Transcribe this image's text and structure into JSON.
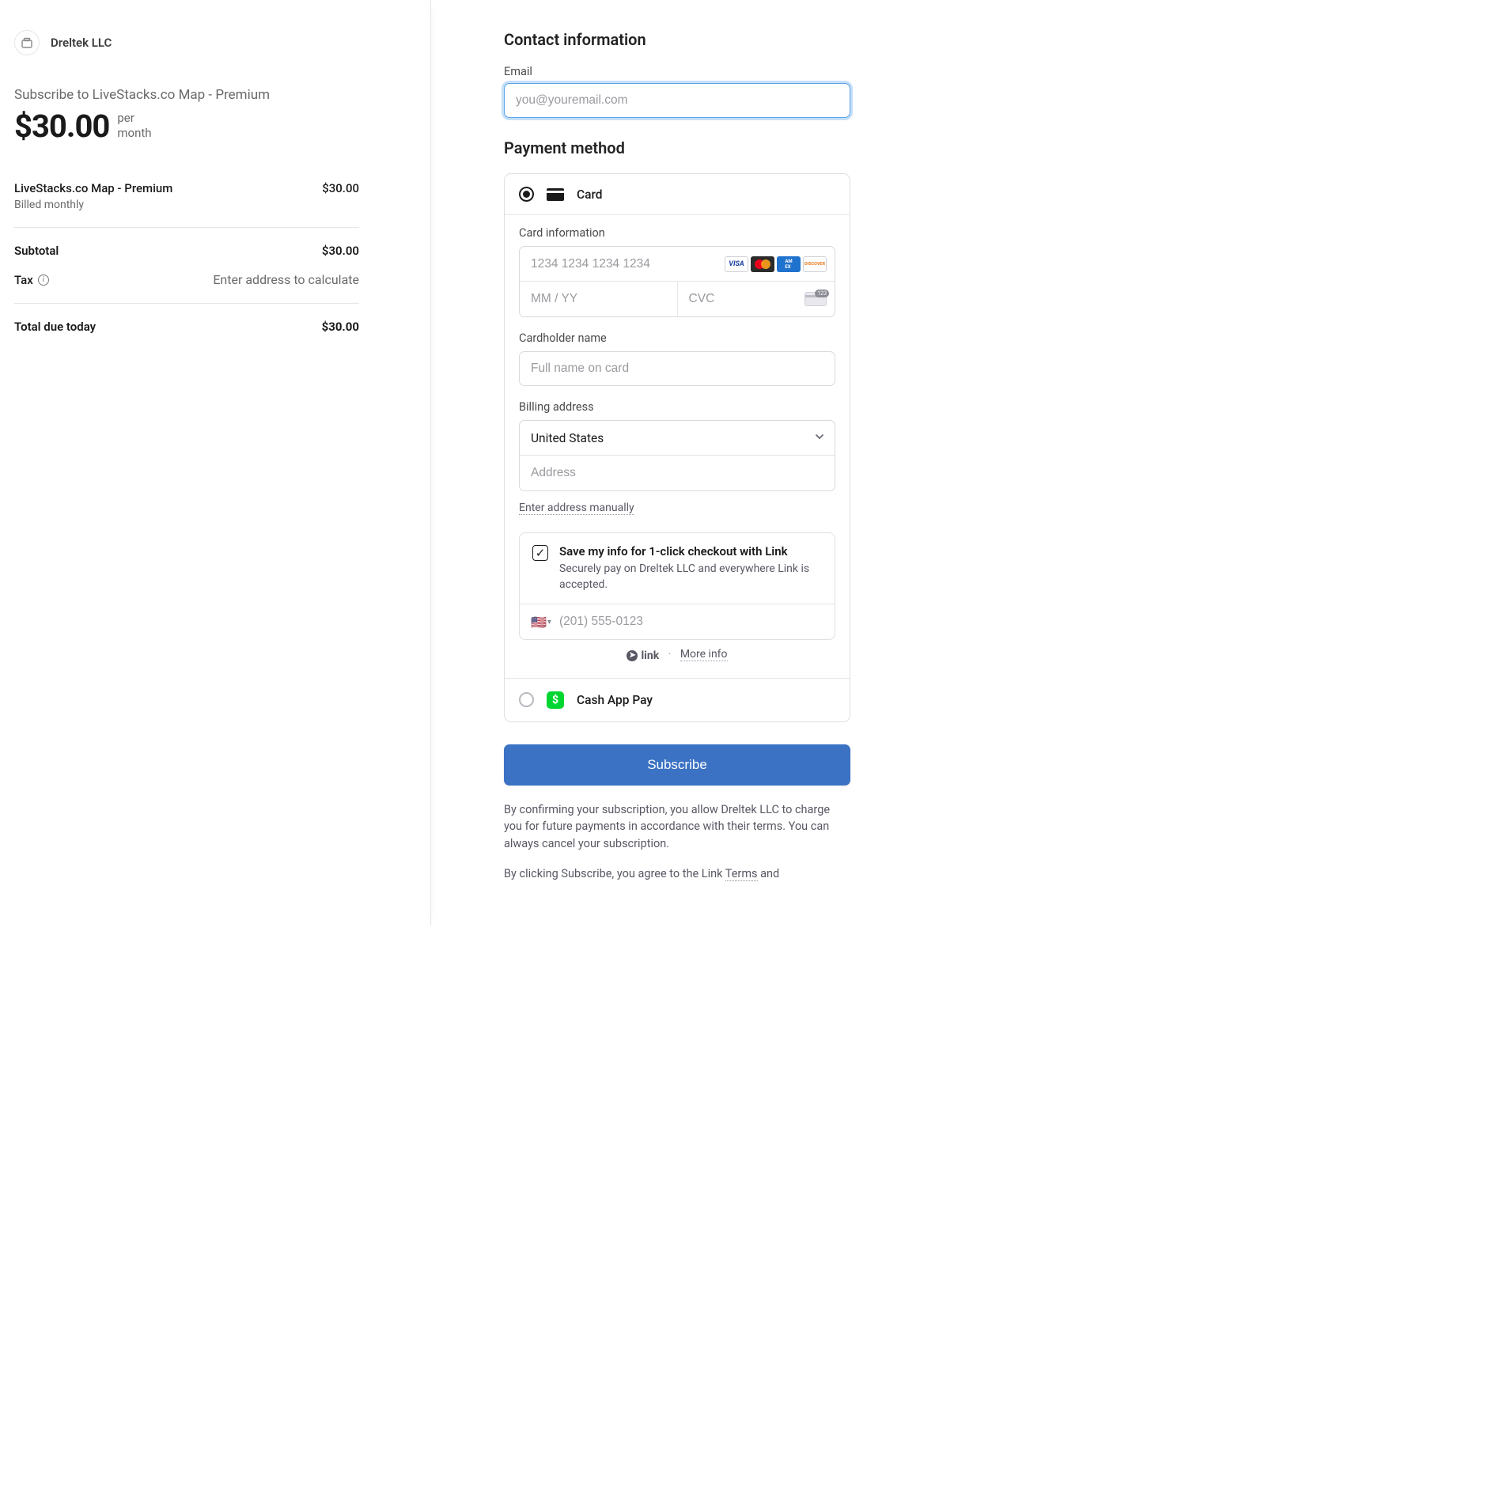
{
  "merchant": {
    "name": "Dreltek LLC"
  },
  "summary": {
    "subscribe_line": "Subscribe to LiveStacks.co Map - Premium",
    "big_price": "$30.00",
    "per": "per",
    "month": "month",
    "line_item_name": "LiveStacks.co Map - Premium",
    "line_item_price": "$30.00",
    "line_item_sub": "Billed monthly",
    "subtotal_label": "Subtotal",
    "subtotal_value": "$30.00",
    "tax_label": "Tax",
    "tax_value": "Enter address to calculate",
    "total_label": "Total due today",
    "total_value": "$30.00"
  },
  "contact": {
    "heading": "Contact information",
    "email_label": "Email",
    "email_placeholder": "you@youremail.com"
  },
  "payment": {
    "heading": "Payment method",
    "card_option_label": "Card",
    "card_info_label": "Card information",
    "card_number_placeholder": "1234 1234 1234 1234",
    "exp_placeholder": "MM / YY",
    "cvc_placeholder": "CVC",
    "cardholder_label": "Cardholder name",
    "cardholder_placeholder": "Full name on card",
    "billing_label": "Billing address",
    "country_value": "United States",
    "address_placeholder": "Address",
    "manual_link": "Enter address manually",
    "link_save_title": "Save my info for 1-click checkout with Link",
    "link_save_desc": "Securely pay on Dreltek LLC and everywhere Link is accepted.",
    "phone_placeholder": "(201) 555-0123",
    "link_brand": "link",
    "more_info": "More info",
    "cashapp_label": "Cash App Pay"
  },
  "cta": {
    "button_label": "Subscribe",
    "legal1": "By confirming your subscription, you allow Dreltek LLC to charge you for future payments in accordance with their terms. You can always cancel your subscription.",
    "legal2_prefix": "By clicking Subscribe, you agree to the Link ",
    "legal2_terms": "Terms",
    "legal2_and": " and"
  }
}
